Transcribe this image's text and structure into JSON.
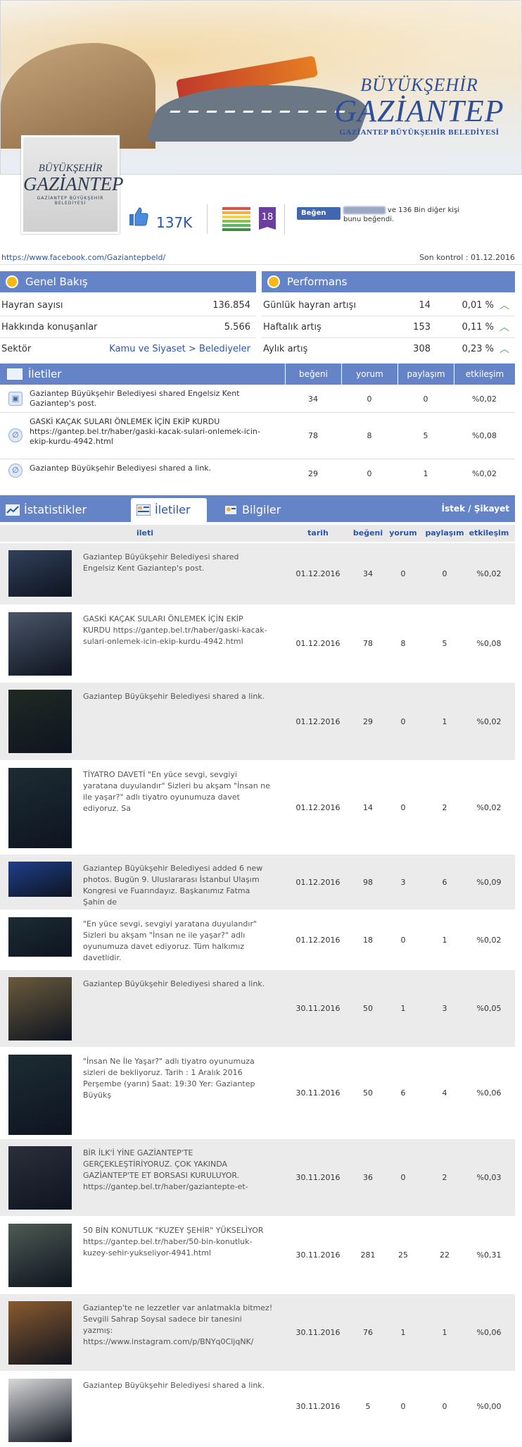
{
  "banner": {
    "logo_line1": "BÜYÜKŞEHİR",
    "logo_line2": "GAZİANTEP",
    "logo_line3": "GAZİANTEP BÜYÜKŞEHİR BELEDİYESİ",
    "profile_line1": "BÜYÜKŞEHİR",
    "profile_line2": "GAZİANTEP",
    "profile_line3": "GAZİANTEP BÜYÜKŞEHİR BELEDİYESİ"
  },
  "stats": {
    "likes": "137K",
    "rank": "18",
    "fb_like_button": "Beğen",
    "fb_like_text_pre": "Yakup Yener",
    "fb_like_text": " ve 136 Bin diğer kişi bunu beğendi."
  },
  "link": {
    "url": "https://www.facebook.com/Gaziantepbeld/",
    "last_check": "Son kontrol : 01.12.2016"
  },
  "overview": {
    "title": "Genel Bakış",
    "rows": [
      {
        "label": "Hayran sayısı",
        "value": "136.854"
      },
      {
        "label": "Hakkında konuşanlar",
        "value": "5.566"
      },
      {
        "label": "Sektör",
        "value": "Kamu ve Siyaset > Belediyeler"
      }
    ]
  },
  "performance": {
    "title": "Performans",
    "rows": [
      {
        "label": "Günlük hayran artışı",
        "v1": "14",
        "v2": "0,01 %"
      },
      {
        "label": "Haftalık artış",
        "v1": "153",
        "v2": "0,11 %"
      },
      {
        "label": "Aylık artış",
        "v1": "308",
        "v2": "0,23 %"
      }
    ]
  },
  "posts_summary": {
    "title": "İletiler",
    "cols": [
      "beğeni",
      "yorum",
      "paylaşım",
      "etkileşim"
    ],
    "rows": [
      {
        "icon": "photo-icon",
        "text": "Gaziantep Büyükşehir Belediyesi shared Engelsiz Kent Gaziantep's post.",
        "likes": "34",
        "comments": "0",
        "shares": "0",
        "engagement": "%0,02"
      },
      {
        "icon": "link-icon",
        "text": "GASKİ KAÇAK SULARI ÖNLEMEK İÇİN EKİP KURDU https://gantep.bel.tr/haber/gaski-kacak-sulari-onlemek-icin-ekip-kurdu-4942.html",
        "likes": "78",
        "comments": "8",
        "shares": "5",
        "engagement": "%0,08"
      },
      {
        "icon": "link-icon",
        "text": "Gaziantep Büyükşehir Belediyesi shared a link.",
        "likes": "29",
        "comments": "0",
        "shares": "1",
        "engagement": "%0,02"
      }
    ]
  },
  "tabs": {
    "items": [
      "İstatistikler",
      "İletiler",
      "Bilgiler"
    ],
    "complaint": "İstek / Şikayet"
  },
  "list": {
    "cols": [
      "ileti",
      "tarih",
      "beğeni",
      "yorum",
      "paylaşım",
      "etkileşim"
    ],
    "rows": [
      {
        "thumb": "#31405a",
        "text": "Gaziantep Büyükşehir Belediyesi shared Engelsiz Kent Gaziantep's post.",
        "date": "01.12.2016",
        "likes": "34",
        "comments": "0",
        "shares": "0",
        "engagement": "%0,02"
      },
      {
        "thumb": "#4a5668",
        "text": "GASKİ KAÇAK SULARI ÖNLEMEK İÇİN EKİP KURDU https://gantep.bel.tr/haber/gaski-kacak-sulari-onlemek-icin-ekip-kurdu-4942.html",
        "date": "01.12.2016",
        "likes": "78",
        "comments": "8",
        "shares": "5",
        "engagement": "%0,08"
      },
      {
        "thumb": "#1f2a22",
        "text": "Gaziantep Büyükşehir Belediyesi shared a link.",
        "date": "01.12.2016",
        "likes": "29",
        "comments": "0",
        "shares": "1",
        "engagement": "%0,02"
      },
      {
        "thumb": "#1c2c33",
        "text": "TİYATRO DAVETİ \"En yüce sevgi, sevgiyi yaratana duyulandır\" Sizleri bu akşam \"İnsan ne ile yaşar?\" adlı tiyatro oyunumuza davet ediyoruz. Sa",
        "date": "01.12.2016",
        "likes": "14",
        "comments": "0",
        "shares": "2",
        "engagement": "%0,02"
      },
      {
        "thumb": "#1e3f8a",
        "text": "Gaziantep Büyükşehir Belediyesi added 6 new photos. Bugün 9. Uluslararası İstanbul Ulaşım Kongresi ve Fuarındayız. Başkanımız Fatma Şahin de",
        "date": "01.12.2016",
        "likes": "98",
        "comments": "3",
        "shares": "6",
        "engagement": "%0,09"
      },
      {
        "thumb": "#1c2c33",
        "text": "\"En yüce sevgi, sevgiyi yaratana duyulandır\" Sizleri bu akşam \"İnsan ne ile yaşar?\" adlı oyunumuza davet ediyoruz. Tüm halkımız davetlidir.",
        "date": "01.12.2016",
        "likes": "18",
        "comments": "0",
        "shares": "1",
        "engagement": "%0,02"
      },
      {
        "thumb": "#6a5a3c",
        "text": "Gaziantep Büyükşehir Belediyesi shared a link.",
        "date": "30.11.2016",
        "likes": "50",
        "comments": "1",
        "shares": "3",
        "engagement": "%0,05"
      },
      {
        "thumb": "#1c2c33",
        "text": "\"İnsan Ne İle Yaşar?\" adlı tiyatro oyunumuza sizleri de bekliyoruz. Tarih : 1 Aralık 2016 Perşembe (yarın) Saat: 19:30 Yer: Gaziantep Büyükş",
        "date": "30.11.2016",
        "likes": "50",
        "comments": "6",
        "shares": "4",
        "engagement": "%0,06"
      },
      {
        "thumb": "#2a2f3a",
        "text": "BİR İLK'İ YİNE GAZİANTEP'TE GERÇEKLEŞTİRİYORUZ. ÇOK YAKINDA GAZİANTEP'TE ET BORSASI KURULUYOR. https://gantep.bel.tr/haber/gaziantepte-et-",
        "date": "30.11.2016",
        "likes": "36",
        "comments": "0",
        "shares": "2",
        "engagement": "%0,03"
      },
      {
        "thumb": "#4d5a52",
        "text": "50 BİN KONUTLUK \"KUZEY ŞEHİR\" YÜKSELİYOR https://gantep.bel.tr/haber/50-bin-konutluk-kuzey-sehir-yukseliyor-4941.html",
        "date": "30.11.2016",
        "likes": "281",
        "comments": "25",
        "shares": "22",
        "engagement": "%0,31"
      },
      {
        "thumb": "#8a5a2e",
        "text": "Gaziantep'te ne lezzetler var anlatmakla bitmez! Sevgili Sahrap Soysal sadece bir tanesini yazmış: https://www.instagram.com/p/BNYq0CljqNK/",
        "date": "30.11.2016",
        "likes": "76",
        "comments": "1",
        "shares": "1",
        "engagement": "%0,06"
      },
      {
        "thumb": "#d9d9d9",
        "text": "Gaziantep Büyükşehir Belediyesi shared a link.",
        "date": "30.11.2016",
        "likes": "5",
        "comments": "0",
        "shares": "0",
        "engagement": "%0,00"
      }
    ]
  },
  "colors": {
    "header_blue": "#6584c8",
    "link_blue": "#2b56a8",
    "rank_purple": "#6b3fa0",
    "growth_green": "#4caf50"
  }
}
